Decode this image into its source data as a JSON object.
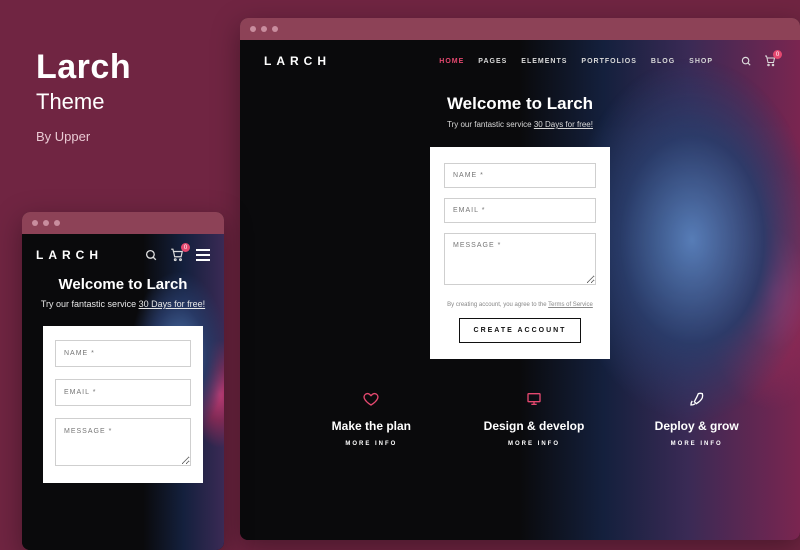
{
  "info": {
    "title": "Larch",
    "subtitle": "Theme",
    "byline": "By Upper"
  },
  "site": {
    "logo": "LARCH",
    "nav": [
      {
        "label": "HOME",
        "active": true
      },
      {
        "label": "PAGES",
        "active": false
      },
      {
        "label": "ELEMENTS",
        "active": false
      },
      {
        "label": "PORTFOLIOS",
        "active": false
      },
      {
        "label": "BLOG",
        "active": false
      },
      {
        "label": "SHOP",
        "active": false
      }
    ],
    "cart_count": "0"
  },
  "hero": {
    "heading": "Welcome to Larch",
    "tagline_pre": "Try our fantastic service ",
    "tagline_link": "30 Days for free!"
  },
  "form": {
    "name_placeholder": "NAME *",
    "email_placeholder": "EMAIL *",
    "message_placeholder": "MESSAGE *",
    "tos_pre": "By creating account, you agree to the ",
    "tos_link": "Terms of Service",
    "button": "CREATE ACCOUNT"
  },
  "features": [
    {
      "icon": "heart-icon",
      "title": "Make the plan",
      "more": "MORE INFO"
    },
    {
      "icon": "monitor-icon",
      "title": "Design & develop",
      "more": "MORE INFO"
    },
    {
      "icon": "rocket-icon",
      "title": "Deploy & grow",
      "more": "MORE INFO"
    }
  ],
  "colors": {
    "accent": "#e4486f"
  }
}
